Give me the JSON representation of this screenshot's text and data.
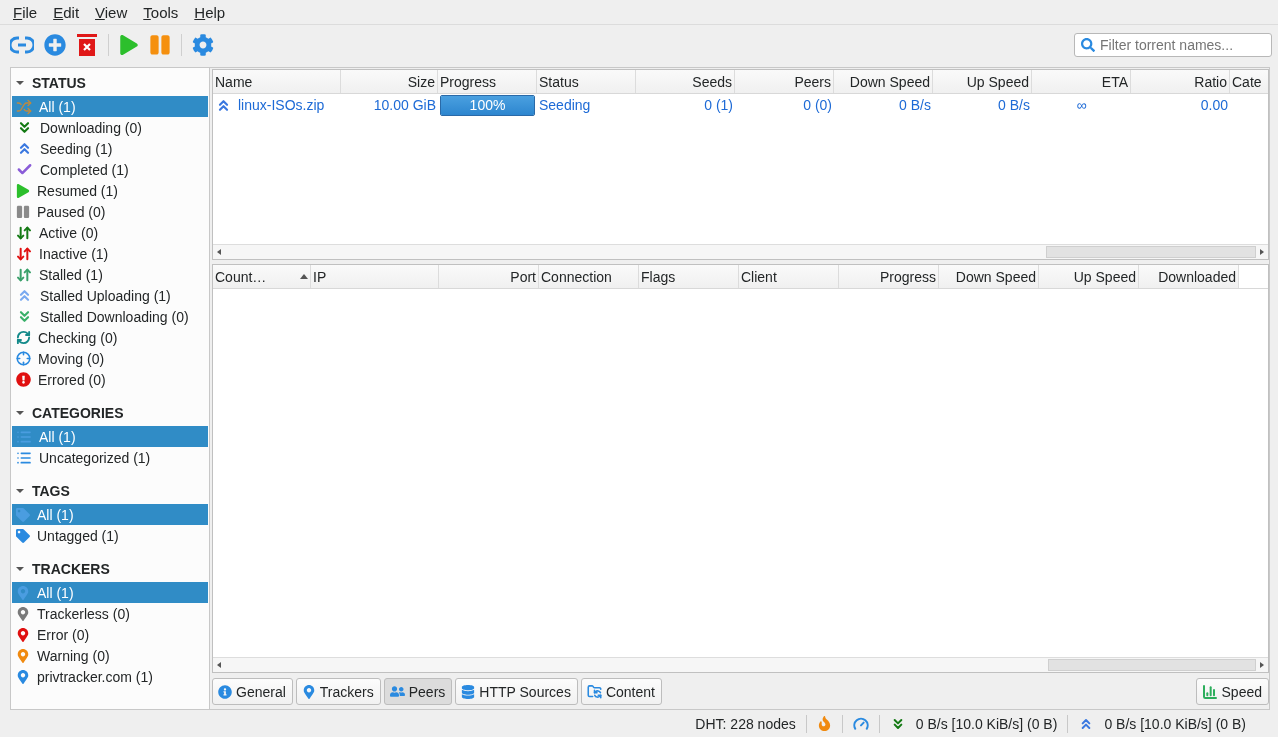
{
  "menu": [
    "File",
    "Edit",
    "View",
    "Tools",
    "Help"
  ],
  "search": {
    "placeholder": "Filter torrent names..."
  },
  "sidebar": [
    {
      "title": "STATUS",
      "expanded": true,
      "items": [
        {
          "label": "All (1)",
          "selected": true
        },
        {
          "label": "Downloading (0)",
          "selected": false
        },
        {
          "label": "Seeding (1)",
          "selected": false
        },
        {
          "label": "Completed (1)",
          "selected": false
        },
        {
          "label": "Resumed (1)",
          "selected": false
        },
        {
          "label": "Paused (0)",
          "selected": false
        },
        {
          "label": "Active (0)",
          "selected": false
        },
        {
          "label": "Inactive (1)",
          "selected": false
        },
        {
          "label": "Stalled (1)",
          "selected": false
        },
        {
          "label": "Stalled Uploading (1)",
          "selected": false
        },
        {
          "label": "Stalled Downloading (0)",
          "selected": false
        },
        {
          "label": "Checking (0)",
          "selected": false
        },
        {
          "label": "Moving (0)",
          "selected": false
        },
        {
          "label": "Errored (0)",
          "selected": false
        }
      ]
    },
    {
      "title": "CATEGORIES",
      "expanded": true,
      "items": [
        {
          "label": "All (1)",
          "selected": true
        },
        {
          "label": "Uncategorized (1)",
          "selected": false
        }
      ]
    },
    {
      "title": "TAGS",
      "expanded": true,
      "items": [
        {
          "label": "All (1)",
          "selected": true
        },
        {
          "label": "Untagged (1)",
          "selected": false
        }
      ]
    },
    {
      "title": "TRACKERS",
      "expanded": true,
      "items": [
        {
          "label": "All (1)",
          "selected": true
        },
        {
          "label": "Trackerless (0)",
          "selected": false
        },
        {
          "label": "Error (0)",
          "selected": false
        },
        {
          "label": "Warning (0)",
          "selected": false
        },
        {
          "label": "privtracker.com (1)",
          "selected": false
        }
      ]
    }
  ],
  "torrents": {
    "columns": [
      "Name",
      "Size",
      "Progress",
      "Status",
      "Seeds",
      "Peers",
      "Down Speed",
      "Up Speed",
      "ETA",
      "Ratio",
      "Cate"
    ],
    "rows": [
      {
        "name": "linux-ISOs.zip",
        "size": "10.00 GiB",
        "progress": {
          "level": 1.0,
          "text": "100%"
        },
        "status": "Seeding",
        "seeds": "0 (1)",
        "peers": "0 (0)",
        "down_speed": "0 B/s",
        "up_speed": "0 B/s",
        "eta": "∞",
        "ratio": "0.00"
      }
    ]
  },
  "peers": {
    "columns": [
      {
        "label": "Count…",
        "sorted": true
      },
      {
        "label": "IP",
        "sorted": false
      },
      {
        "label": "Port",
        "sorted": false
      },
      {
        "label": "Connection",
        "sorted": false
      },
      {
        "label": "Flags",
        "sorted": false
      },
      {
        "label": "Client",
        "sorted": false
      },
      {
        "label": "Progress",
        "sorted": false
      },
      {
        "label": "Down Speed",
        "sorted": false
      },
      {
        "label": "Up Speed",
        "sorted": false
      },
      {
        "label": "Downloaded",
        "sorted": false
      }
    ]
  },
  "detail_tabs": [
    {
      "label": "General",
      "selected": false
    },
    {
      "label": "Trackers",
      "selected": false
    },
    {
      "label": "Peers",
      "selected": true
    },
    {
      "label": "HTTP Sources",
      "selected": false
    },
    {
      "label": "Content",
      "selected": false
    }
  ],
  "speed_button": "Speed",
  "status_bar": {
    "dht": "DHT: 228 nodes",
    "download": "0 B/s [10.0 KiB/s] (0 B)",
    "upload": "0 B/s [10.0 KiB/s] (0 B)"
  }
}
